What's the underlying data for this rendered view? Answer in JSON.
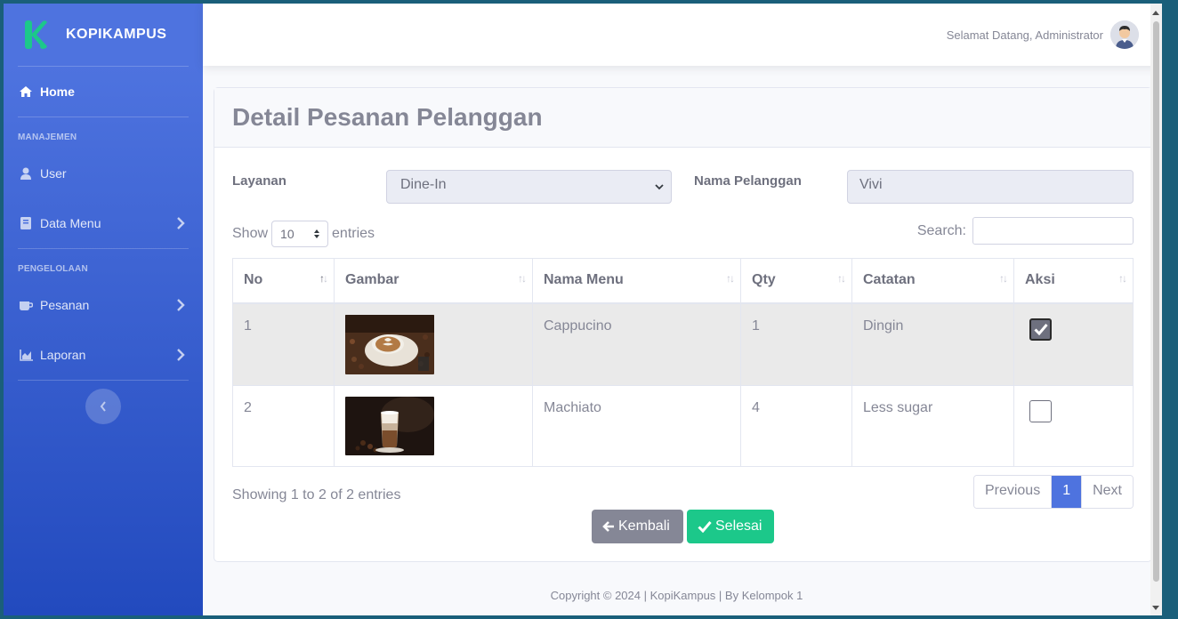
{
  "brand": {
    "name": "KOPIKAMPUS"
  },
  "sidebar": {
    "home_label": "Home",
    "heading_manajemen": "MANAJEMEN",
    "user_label": "User",
    "data_menu_label": "Data Menu",
    "heading_pengelolaan": "PENGELOLAAN",
    "pesanan_label": "Pesanan",
    "laporan_label": "Laporan"
  },
  "topbar": {
    "welcome": "Selamat Datang, Administrator"
  },
  "page": {
    "title": "Detail Pesanan Pelanggan",
    "layanan_label": "Layanan",
    "layanan_value": "Dine-In",
    "nama_label": "Nama Pelanggan",
    "nama_value": "Vivi"
  },
  "datatable": {
    "show_label": "Show",
    "entries_label": "entries",
    "length_value": "10",
    "search_label": "Search:",
    "columns": [
      "No",
      "Gambar",
      "Nama Menu",
      "Qty",
      "Catatan",
      "Aksi"
    ],
    "rows": [
      {
        "no": "1",
        "nama_menu": "Cappucino",
        "qty": "1",
        "catatan": "Dingin",
        "checked": true
      },
      {
        "no": "2",
        "nama_menu": "Machiato",
        "qty": "4",
        "catatan": "Less sugar",
        "checked": false
      }
    ],
    "info": "Showing 1 to 2 of 2 entries",
    "pager": {
      "previous": "Previous",
      "current": "1",
      "next": "Next"
    }
  },
  "actions": {
    "back_label": "Kembali",
    "done_label": "Selesai"
  },
  "footer": {
    "text": "Copyright © 2024 | KopiKampus | By Kelompok 1"
  },
  "colors": {
    "primary": "#4e73df",
    "success": "#1cc88a",
    "secondary": "#858796",
    "brand_green": "#1cc88a"
  }
}
